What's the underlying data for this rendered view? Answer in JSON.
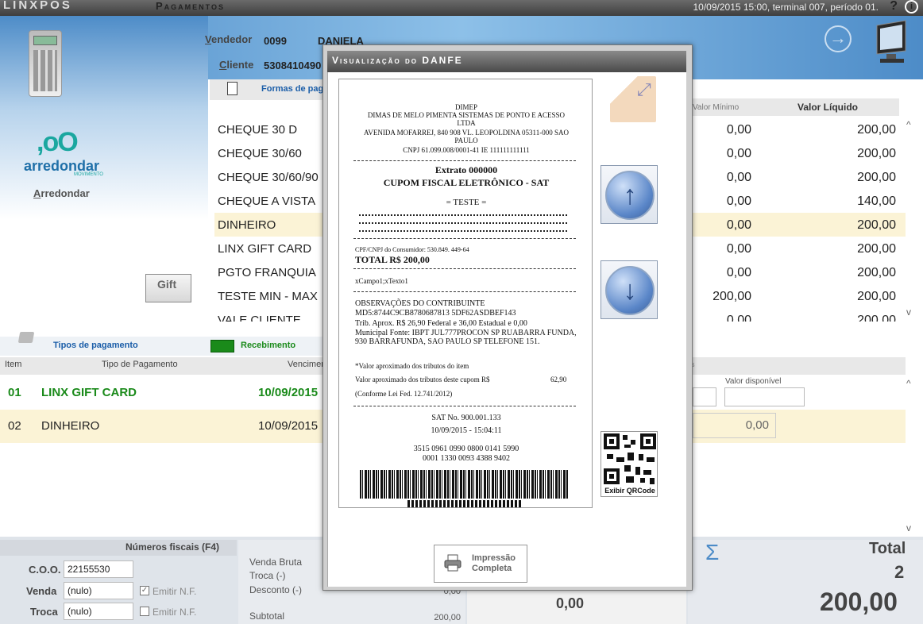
{
  "topbar": {
    "brand": "LINXPOS",
    "title": "Pagamentos",
    "status": "10/09/2015 15:00, terminal 007, período 01.",
    "help": "?",
    "info": "i"
  },
  "header": {
    "seller_label": "Vendedor",
    "seller_code": "0099",
    "seller_name": "DANIELA",
    "client_label": "Cliente",
    "client_code": "5308410490"
  },
  "left": {
    "arred_mark": ",oO",
    "arred_word": "arredondar",
    "arred_sub": "MOVIMENTO",
    "arred_link": "Arredondar",
    "gift": "Gift"
  },
  "forms": {
    "label": "Formas de pagamento"
  },
  "payment_methods": [
    {
      "name": "CHEQUE 30 D",
      "min": "0,00",
      "liquid": "200,00"
    },
    {
      "name": "CHEQUE 30/60",
      "min": "0,00",
      "liquid": "200,00"
    },
    {
      "name": "CHEQUE 30/60/90",
      "min": "0,00",
      "liquid": "200,00"
    },
    {
      "name": "CHEQUE A VISTA",
      "min": "0,00",
      "liquid": "140,00"
    },
    {
      "name": "DINHEIRO",
      "min": "0,00",
      "liquid": "200,00"
    },
    {
      "name": "LINX GIFT CARD",
      "min": "0,00",
      "liquid": "200,00"
    },
    {
      "name": "PGTO FRANQUIA",
      "min": "0,00",
      "liquid": "200,00"
    },
    {
      "name": "TESTE MIN - MAX",
      "min": "200,00",
      "liquid": "200,00"
    },
    {
      "name": "VALE CLIENTE",
      "min": "0,00",
      "liquid": "200,00"
    }
  ],
  "columns": {
    "min": "Valor Mínimo",
    "liquid": "Valor Líquido"
  },
  "tipos": {
    "label": "Tipos de pagamento",
    "receb": "Recebimento"
  },
  "table_headers": {
    "item": "Item",
    "tipo": "Tipo de Pagamento",
    "venc": "Vencimento",
    "right": "s",
    "avail": "Valor disponível"
  },
  "rows": [
    {
      "item": "01",
      "tipo": "LINX GIFT CARD",
      "venc": "10/09/2015"
    },
    {
      "item": "02",
      "tipo": "DINHEIRO",
      "venc": "10/09/2015",
      "value": "0,00"
    }
  ],
  "fiscal": {
    "title": "Números fiscais (F4)",
    "coo_label": "C.O.O.",
    "coo": "22155530",
    "venda_label": "Venda",
    "venda": "(nulo)",
    "troca_label": "Troca",
    "troca": "(nulo)",
    "emitir1": "Emitir N.F.",
    "emitir2": "Emitir N.F.",
    "check1": "✓"
  },
  "summary": {
    "bruta": "Venda Bruta",
    "troca": "Troca (-)",
    "desconto": "Desconto (-)",
    "desconto_val": "0,00",
    "subtotal": "Subtotal",
    "subtotal_val": "200,00",
    "change": "0,00"
  },
  "total": {
    "sigma": "Σ",
    "title": "Total",
    "count": "2",
    "value": "200,00"
  },
  "modal": {
    "title": "Visualização do DANFE",
    "receipt": {
      "l1": "DIMEP",
      "l2": "DIMAS DE MELO PIMENTA SISTEMAS DE PONTO E ACESSO LTDA",
      "l3": "AVENIDA MOFARREJ, 840 908 VL. LEOPOLDINA 05311-000 SAO PAULO",
      "l4": "CNPJ 61.099.008/0001-41 IE 111111111111",
      "extrato": "Extrato 000000",
      "cupom": "CUPOM FISCAL ELETRÔNICO - SAT",
      "teste": "= TESTE =",
      "cpf": "CPF/CNPJ do Consumidor: 530.849. 449-64",
      "total": "TOTAL R$ 200,00",
      "campo": "xCampo1;xTexto1",
      "obs": "OBSERVAÇÕES DO CONTRIBUINTE",
      "md5": "MD5:8744C9CB8780687813 5DF62ASDBEF143",
      "trib": "Trib. Aprox. R$ 26,90 Federal e 36,00 Estadual e 0,00",
      "fonte": "Municipal Fonte: IBPT JUL777PROCON SP  RUABARRA FUNDA, 930 BARRAFUNDA, SAO PAULO SP TELEFONE 151.",
      "aprox": "*Valor aproximado dos tributos do item",
      "aprox2": "Valor aproximado dos tributos deste cupom R$",
      "aprox2_val": "62,90",
      "lei": "(Conforme Lei Fed. 12.741/2012)",
      "sat": "SAT No. 900.001.133",
      "dt": "10/09/2015 - 15:04:11",
      "key1": "3515 0961 0990 0800 0141 5990",
      "key2": "0001 1330 0093 4388 9402"
    },
    "qr_label": "Exibir QRCode",
    "print_l1": "Impressão",
    "print_l2": "Completa"
  }
}
